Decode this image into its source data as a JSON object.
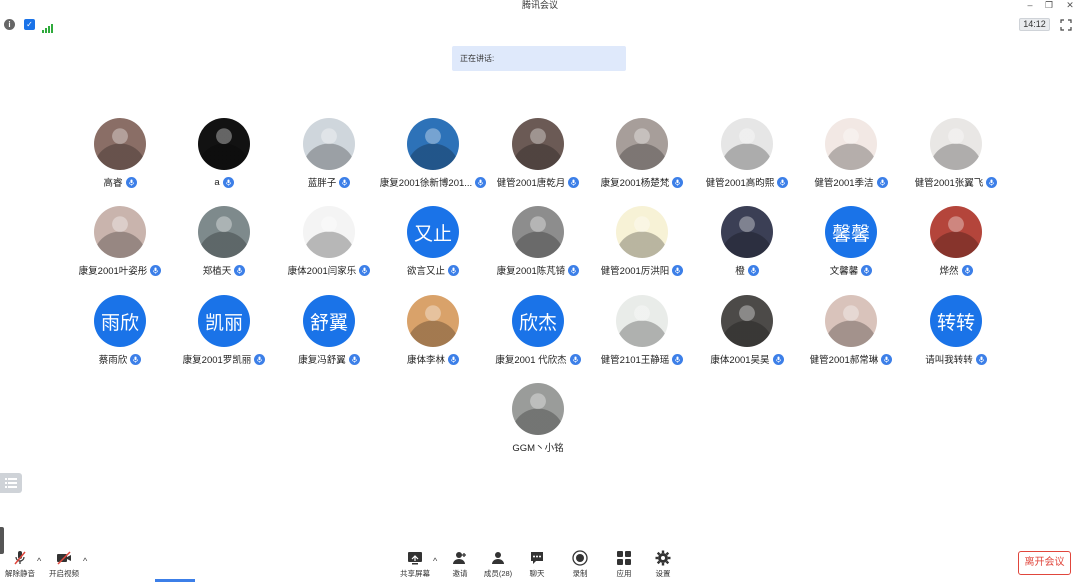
{
  "window": {
    "title": "腾讯会议"
  },
  "status": {
    "time": "14:12"
  },
  "speaking": {
    "label": "正在讲话:"
  },
  "participants": [
    {
      "name": "高睿",
      "avatar_type": "photo",
      "avatar_color": "#8a6e66"
    },
    {
      "name": "a",
      "avatar_type": "photo",
      "avatar_color": "#121212"
    },
    {
      "name": "蓝胖子",
      "avatar_type": "photo",
      "avatar_color": "#cfd6dc"
    },
    {
      "name": "康复2001徐新博201...",
      "avatar_type": "photo",
      "avatar_color": "#2d72b8"
    },
    {
      "name": "健管2001唐乾月",
      "avatar_type": "photo",
      "avatar_color": "#6b5a55"
    },
    {
      "name": "康复2001杨楚梵",
      "avatar_type": "photo",
      "avatar_color": "#a79e9a"
    },
    {
      "name": "健管2001高昀熙",
      "avatar_type": "photo",
      "avatar_color": "#e6e6e6"
    },
    {
      "name": "健管2001季洁",
      "avatar_type": "photo",
      "avatar_color": "#f2e8e4"
    },
    {
      "name": "健管2001张翼飞",
      "avatar_type": "photo",
      "avatar_color": "#e9e7e5"
    },
    {
      "name": "康复2001叶姿彤",
      "avatar_type": "photo",
      "avatar_color": "#c9b4ad"
    },
    {
      "name": "郑植天",
      "avatar_type": "photo",
      "avatar_color": "#7e8a8c"
    },
    {
      "name": "康体2001闫家乐",
      "avatar_type": "photo",
      "avatar_color": "#f4f4f4"
    },
    {
      "name": "欲言又止",
      "avatar_type": "text",
      "avatar_text": "又止",
      "avatar_color": "#1a73e8"
    },
    {
      "name": "康复2001陈芃锜",
      "avatar_type": "photo",
      "avatar_color": "#8d8d8d"
    },
    {
      "name": "健管2001厉洪阳",
      "avatar_type": "photo",
      "avatar_color": "#f7f2d6"
    },
    {
      "name": "橙",
      "avatar_type": "photo",
      "avatar_color": "#3b3f55"
    },
    {
      "name": "文馨馨",
      "avatar_type": "text",
      "avatar_text": "馨馨",
      "avatar_color": "#1a73e8"
    },
    {
      "name": "烨然",
      "avatar_type": "photo",
      "avatar_color": "#b4453b"
    },
    {
      "name": "蔡雨欣",
      "avatar_type": "text",
      "avatar_text": "雨欣",
      "avatar_color": "#1a73e8"
    },
    {
      "name": "康复2001罗凯丽",
      "avatar_type": "text",
      "avatar_text": "凯丽",
      "avatar_color": "#1a73e8"
    },
    {
      "name": "康复冯舒翼",
      "avatar_type": "text",
      "avatar_text": "舒翼",
      "avatar_color": "#1a73e8"
    },
    {
      "name": "康体李林",
      "avatar_type": "photo",
      "avatar_color": "#d9a26a"
    },
    {
      "name": "康复2001 代欣杰",
      "avatar_type": "text",
      "avatar_text": "欣杰",
      "avatar_color": "#1a73e8"
    },
    {
      "name": "健管2101王静瑶",
      "avatar_type": "photo",
      "avatar_color": "#e9ece9"
    },
    {
      "name": "康体2001吴昊",
      "avatar_type": "photo",
      "avatar_color": "#4c4a48"
    },
    {
      "name": "健管2001郝常琳",
      "avatar_type": "photo",
      "avatar_color": "#d9c3bb"
    },
    {
      "name": "请叫我转转",
      "avatar_type": "text",
      "avatar_text": "转转",
      "avatar_color": "#1a73e8"
    },
    {
      "name": "GGM丶小铭",
      "avatar_type": "photo",
      "avatar_color": "#9a9c9a"
    }
  ],
  "toolbar": {
    "unmute": "解除静音",
    "start_video": "开启视频",
    "share_screen": "共享屏幕",
    "invite": "邀请",
    "members": "成员(28)",
    "chat": "聊天",
    "record": "录制",
    "apps": "应用",
    "settings": "设置",
    "leave": "离开会议"
  },
  "colors": {
    "accent": "#1a73e8",
    "leave": "#e0463c",
    "speaking_bg": "#dfe9fb"
  }
}
